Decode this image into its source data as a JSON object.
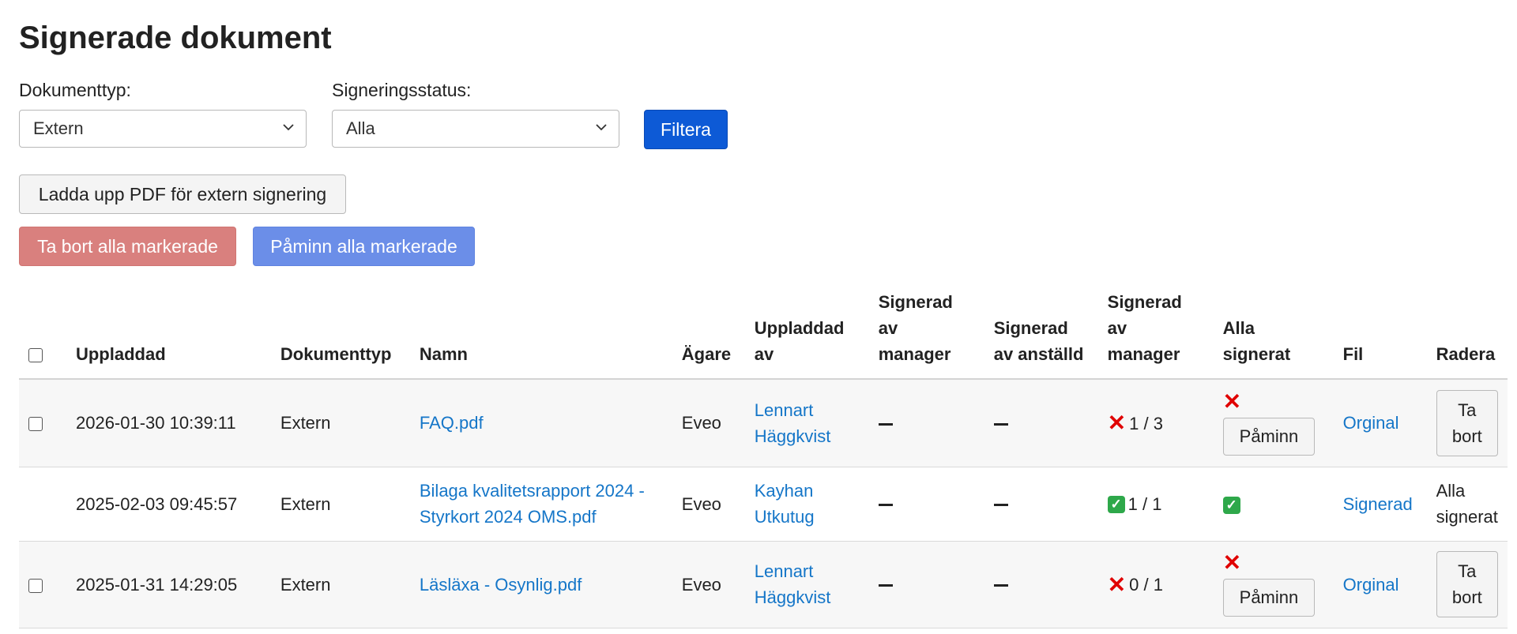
{
  "page": {
    "title": "Signerade dokument"
  },
  "filters": {
    "doc_type_label": "Dokumenttyp:",
    "doc_type_value": "Extern",
    "status_label": "Signeringsstatus:",
    "status_value": "Alla",
    "filter_button": "Filtera"
  },
  "actions": {
    "upload": "Ladda upp PDF för extern signering",
    "delete_selected": "Ta bort alla markerade",
    "remind_selected": "Påminn alla markerade"
  },
  "colors": {
    "primary": "#0d5ad6",
    "danger": "#d9807e",
    "info": "#6b8ee8",
    "link": "#1576c8",
    "error_x": "#e00000",
    "ok_check": "#2ea84a"
  },
  "table": {
    "headers": {
      "uploaded": "Uppladdad",
      "doc_type": "Dokumenttyp",
      "name": "Namn",
      "owner": "Ägare",
      "uploaded_by": "Uppladdad av",
      "signed_manager_1": "Signerad av manager",
      "signed_employee": "Signerad av anställd",
      "signed_manager_2": "Signerad av manager",
      "all_signed": "Alla signerat",
      "file": "Fil",
      "delete": "Radera"
    },
    "rows": [
      {
        "uploaded": "2026-01-30 10:39:11",
        "doc_type": "Extern",
        "name": "FAQ.pdf",
        "owner": "Eveo",
        "uploaded_by": "Lennart Häggkvist",
        "manager_count": "1 / 3",
        "manager_status_icon": "cross-icon",
        "remind_button": "Påminn",
        "file_link": "Orginal",
        "delete_button": "Ta bort"
      },
      {
        "uploaded": "2025-02-03 09:45:57",
        "doc_type": "Extern",
        "name": "Bilaga kvalitetsrapport 2024 - Styrkort 2024 OMS.pdf",
        "owner": "Eveo",
        "uploaded_by": "Kayhan Utkutug",
        "manager_count": "1 / 1",
        "manager_status_icon": "check-icon",
        "file_link": "Signerad",
        "all_signed_text": "Alla signerat"
      },
      {
        "uploaded": "2025-01-31 14:29:05",
        "doc_type": "Extern",
        "name": "Läsläxa - Osynlig.pdf",
        "owner": "Eveo",
        "uploaded_by": "Lennart Häggkvist",
        "manager_count": "0 / 1",
        "manager_status_icon": "cross-icon",
        "remind_button": "Påminn",
        "file_link": "Orginal",
        "delete_button": "Ta bort"
      }
    ]
  }
}
